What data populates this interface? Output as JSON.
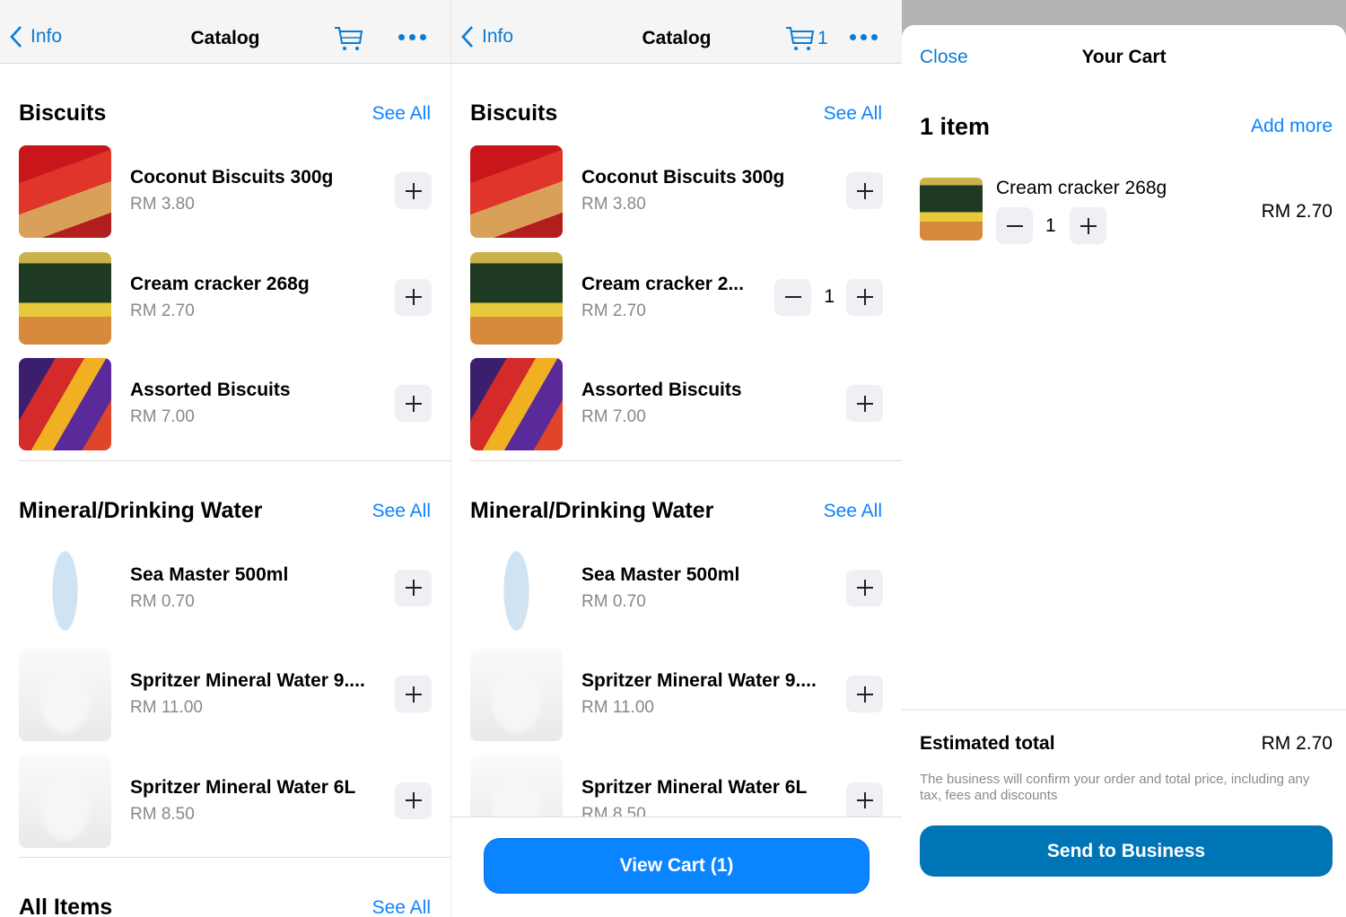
{
  "colors": {
    "accent": "#0a84ff",
    "nav_link": "#0a7bd4",
    "send_button": "#0075b5",
    "view_cart_button": "#0a84ff"
  },
  "catalog_before": {
    "nav": {
      "back_label": "Info",
      "title": "Catalog",
      "cart_count": ""
    },
    "sections": [
      {
        "title": "Biscuits",
        "see_all": "See All",
        "items": [
          {
            "name": "Coconut Biscuits 300g",
            "price": "RM 3.80",
            "thumb": "roma-red"
          },
          {
            "name": "Cream cracker 268g",
            "price": "RM 2.70",
            "thumb": "cream-cracker"
          },
          {
            "name": "Assorted Biscuits",
            "price": "RM 7.00",
            "thumb": "assorted"
          }
        ]
      },
      {
        "title": "Mineral/Drinking Water",
        "see_all": "See All",
        "items": [
          {
            "name": "Sea Master 500ml",
            "price": "RM 0.70",
            "thumb": "bottle"
          },
          {
            "name": "Spritzer Mineral Water 9....",
            "price": "RM 11.00",
            "thumb": "jug"
          },
          {
            "name": "Spritzer Mineral Water 6L",
            "price": "RM 8.50",
            "thumb": "jug"
          }
        ]
      },
      {
        "title": "All Items",
        "see_all": "See All",
        "items": []
      }
    ]
  },
  "catalog_after": {
    "nav": {
      "back_label": "Info",
      "title": "Catalog",
      "cart_count": "1"
    },
    "sections": [
      {
        "title": "Biscuits",
        "see_all": "See All",
        "items": [
          {
            "name": "Coconut Biscuits 300g",
            "price": "RM 3.80",
            "thumb": "roma-red"
          },
          {
            "name": "Cream cracker 2...",
            "price": "RM 2.70",
            "thumb": "cream-cracker",
            "qty": "1"
          },
          {
            "name": "Assorted Biscuits",
            "price": "RM 7.00",
            "thumb": "assorted"
          }
        ]
      },
      {
        "title": "Mineral/Drinking Water",
        "see_all": "See All",
        "items": [
          {
            "name": "Sea Master 500ml",
            "price": "RM 0.70",
            "thumb": "bottle"
          },
          {
            "name": "Spritzer Mineral Water 9....",
            "price": "RM 11.00",
            "thumb": "jug"
          },
          {
            "name": "Spritzer Mineral Water 6L",
            "price": "RM 8.50",
            "thumb": "jug"
          }
        ]
      }
    ],
    "view_cart": "View Cart (1)"
  },
  "cart": {
    "close": "Close",
    "title": "Your Cart",
    "count": "1 item",
    "add_more": "Add more",
    "items": [
      {
        "name": "Cream cracker 268g",
        "qty": "1",
        "price": "RM 2.70",
        "thumb": "cream-cracker"
      }
    ],
    "estimated_label": "Estimated total",
    "estimated_value": "RM 2.70",
    "note": "The business will confirm your order and total price, including any tax, fees and discounts",
    "send": "Send to Business"
  }
}
